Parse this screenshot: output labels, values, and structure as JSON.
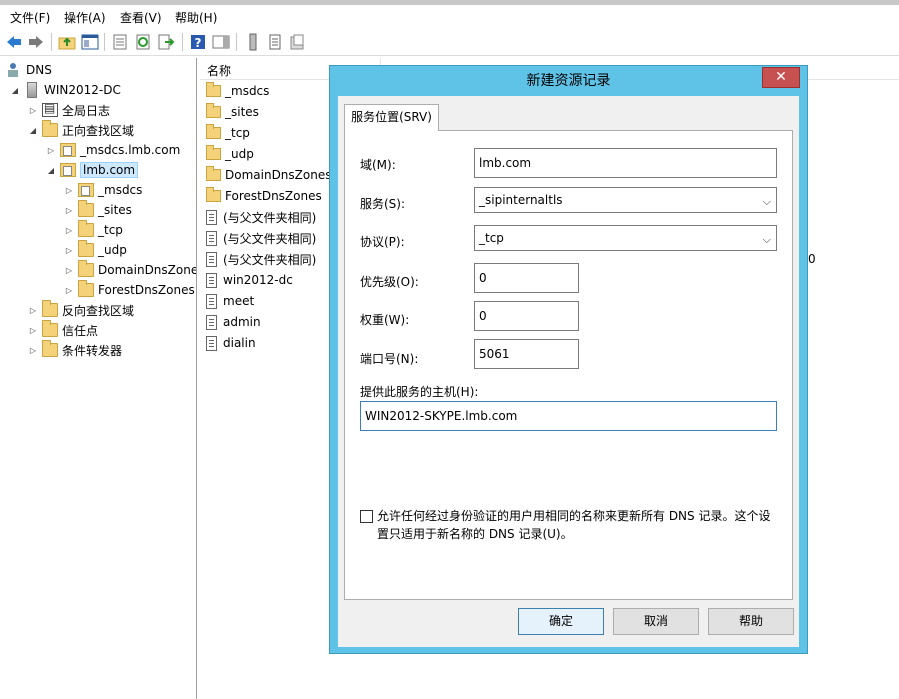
{
  "menu": [
    "文件(F)",
    "操作(A)",
    "查看(V)",
    "帮助(H)"
  ],
  "tree": {
    "root": "DNS",
    "server": "WIN2012-DC",
    "global_logs": "全局日志",
    "forward_zones": "正向查找区域",
    "msdcs_zone": "_msdcs.lmb.com",
    "lmb_zone": "lmb.com",
    "lmb_children": [
      "_msdcs",
      "_sites",
      "_tcp",
      "_udp",
      "DomainDnsZones",
      "ForestDnsZones"
    ],
    "reverse_zones": "反向查找区域",
    "trust_points": "信任点",
    "conditional_forwarders": "条件转发器"
  },
  "list": {
    "column_name": "名称",
    "folders": [
      "_msdcs",
      "_sites",
      "_tcp",
      "_udp",
      "DomainDnsZones",
      "ForestDnsZones"
    ],
    "records": [
      "(与父文件夹相同)",
      "(与父文件夹相同)",
      "(与父文件夹相同)",
      "win2012-dc",
      "meet",
      "admin",
      "dialin"
    ],
    "partial_value": "0"
  },
  "dialog": {
    "title": "新建资源记录",
    "close": "✕",
    "tab": "服务位置(SRV)",
    "domain_label": "域(M):",
    "domain_value": "lmb.com",
    "service_label": "服务(S):",
    "service_value": "_sipinternaltls",
    "protocol_label": "协议(P):",
    "protocol_value": "_tcp",
    "priority_label": "优先级(O):",
    "priority_value": "0",
    "weight_label": "权重(W):",
    "weight_value": "0",
    "port_label": "端口号(N):",
    "port_value": "5061",
    "host_label": "提供此服务的主机(H):",
    "host_value": "WIN2012-SKYPE.lmb.com",
    "checkbox_text_line1": "允许任何经过身份验证的用户用相同的名称来更新所有 DNS 记录。这个设",
    "checkbox_text_line2": "置只适用于新名称的 DNS 记录(U)。",
    "ok": "确定",
    "cancel": "取消",
    "help": "帮助"
  }
}
